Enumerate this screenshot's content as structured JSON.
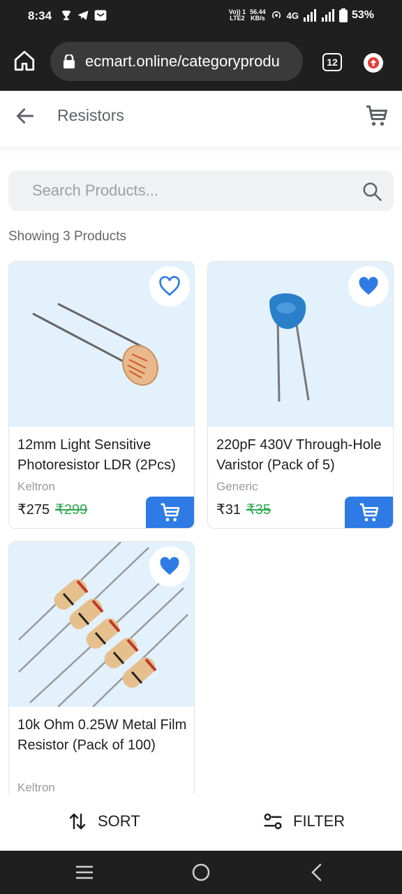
{
  "status_bar": {
    "time": "8:34",
    "net_top": "Vo)) 1",
    "net_bottom": "LTE2",
    "speed_value": "56.44",
    "speed_unit": "KB/s",
    "network": "4G",
    "battery": "53%"
  },
  "browser": {
    "url": "ecmart.online/categoryprodu",
    "tab_count": "12"
  },
  "header": {
    "title": "Resistors"
  },
  "search": {
    "placeholder": "Search Products..."
  },
  "results": {
    "summary": "Showing 3 Products"
  },
  "products": [
    {
      "name": "12mm Light Sensitive Photoresistor LDR (2Pcs)",
      "brand": "Keltron",
      "price": "₹275",
      "mrp": "₹299",
      "favorite": false
    },
    {
      "name": "220pF 430V Through-Hole Varistor (Pack of 5)",
      "brand": "Generic",
      "price": "₹31",
      "mrp": "₹35",
      "favorite": true
    },
    {
      "name": "10k Ohm 0.25W Metal Film Resistor (Pack of 100)",
      "brand": "Keltron",
      "favorite": true
    }
  ],
  "actions": {
    "sort_label": "SORT",
    "filter_label": "FILTER"
  },
  "colors": {
    "accent": "#2e7be6",
    "mrp_strike": "#2fa84f",
    "image_bg": "#e3f1fd"
  }
}
